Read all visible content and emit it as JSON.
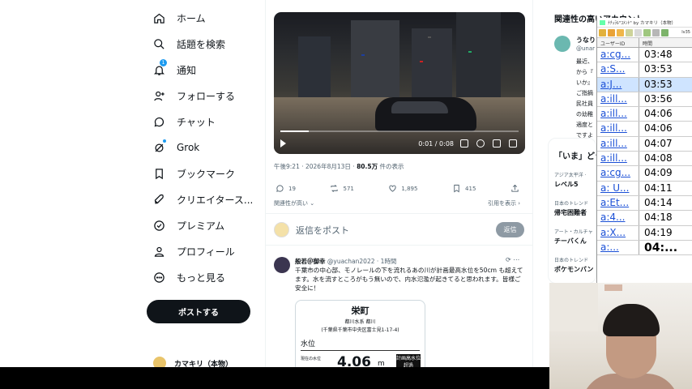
{
  "nav": {
    "items": [
      {
        "label": "ホーム",
        "icon": "home-icon"
      },
      {
        "label": "話題を検索",
        "icon": "search-icon"
      },
      {
        "label": "通知",
        "icon": "bell-icon",
        "badge": "1"
      },
      {
        "label": "フォローする",
        "icon": "person-add-icon"
      },
      {
        "label": "チャット",
        "icon": "chat-icon"
      },
      {
        "label": "Grok",
        "icon": "grok-icon"
      },
      {
        "label": "ブックマーク",
        "icon": "bookmark-icon"
      },
      {
        "label": "クリエイタース...",
        "icon": "rocket-icon"
      },
      {
        "label": "プレミアム",
        "icon": "verified-icon"
      },
      {
        "label": "プロフィール",
        "icon": "profile-icon"
      },
      {
        "label": "もっと見る",
        "icon": "more-icon"
      }
    ],
    "post_button": "ポストする",
    "account_name": "カマキリ（本物）"
  },
  "main": {
    "video": {
      "time": "0:01 / 0:08",
      "progress_fraction": 0.12
    },
    "meta": {
      "datetime": "午後9:21 · 2026年8月13日 · ",
      "views_count": "80.5万",
      "views_suffix": " 件の表示"
    },
    "actions": {
      "replies": "19",
      "reposts": "571",
      "likes": "1,895",
      "bookmarks": "415"
    },
    "relevance": "関連性が高い",
    "view_quotes": "引用を表示 ›",
    "reply_placeholder": "返信をポスト",
    "reply_button": "返信",
    "reply_tweet": {
      "name": "般若＠御幸",
      "handle": "@yuachan2022 · 1時間",
      "text": "千葉市の中心部、モノレールの下を流れるあの川が計画最高水位を50cm も超えてます。水を流すところがもう無いので、内水氾濫が起きてると思われます。皆様ご安全に！",
      "card": {
        "title": "栄町",
        "river": "都川水系 都川",
        "address": "(千葉県千葉市中央区富士見1-17-4)",
        "section": "水位",
        "label": "現在の水位",
        "value": "4.06",
        "unit": "m",
        "tag": "計画高水位超過"
      }
    }
  },
  "right": {
    "title": "関連性の高いアカウント",
    "user": {
      "name": "うなり",
      "handle": "@unar"
    },
    "bio": [
      "最近、",
      "から『",
      "いか』",
      "ご指摘",
      "民社員",
      "の幼稚",
      "適度と",
      "ですよ"
    ],
    "now_title": "「いま」どうしてる？",
    "trends": [
      {
        "context": "アジア太平洋 ·",
        "name": "レベル5"
      },
      {
        "context": "日本のトレンド",
        "name": "帰宅困難者"
      },
      {
        "context": "アート・カルチャ",
        "name": "チーバくん"
      },
      {
        "context": "日本のトレンド",
        "name": "ポケモンバン"
      }
    ]
  },
  "overlay": {
    "title": "ﾅﾁｭﾗﾙ\"ｺﾒﾝﾄ\" by カマキリ（本物）",
    "level": "lv35",
    "col_user": "ユーザーID",
    "col_time": "時間",
    "rows": [
      {
        "id": "a:cg...",
        "time": "03:48"
      },
      {
        "id": "a:S...",
        "time": "03:53"
      },
      {
        "id": "a:J...",
        "time": "03:53",
        "selected": true
      },
      {
        "id": "a:ill...",
        "time": "03:56"
      },
      {
        "id": "a:ill...",
        "time": "04:06"
      },
      {
        "id": "a:ill...",
        "time": "04:06"
      },
      {
        "id": "a:ill...",
        "time": "04:07"
      },
      {
        "id": "a:ill...",
        "time": "04:08"
      },
      {
        "id": "a:cg...",
        "time": "04:09"
      },
      {
        "id": "a: U...",
        "time": "04:11"
      },
      {
        "id": "a:Et...",
        "time": "04:14"
      },
      {
        "id": "a:4...",
        "time": "04:18"
      },
      {
        "id": "a:X...",
        "time": "04:19"
      },
      {
        "id": "a:...",
        "time": "04:..."
      }
    ]
  },
  "colors": {
    "accent": "#1d9bf0",
    "text": "#0f1419",
    "muted": "#536471"
  }
}
